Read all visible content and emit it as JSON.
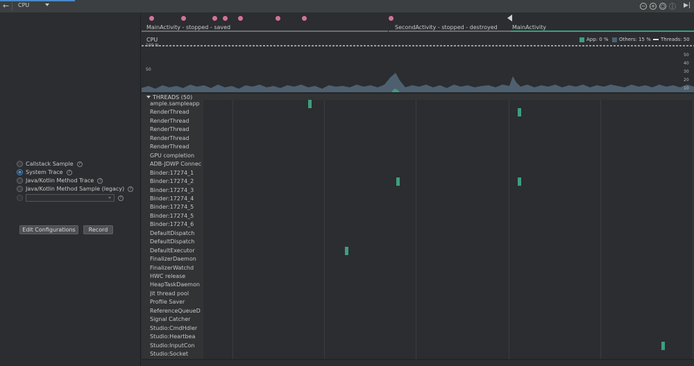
{
  "toolbar": {
    "back_icon": "arrow-left-icon",
    "stage_label": "CPU",
    "icons": [
      "zoom-out-icon",
      "zoom-in-icon",
      "reset-zoom-icon",
      "pause-icon",
      "skip-to-end-icon"
    ]
  },
  "recording": {
    "options": [
      {
        "label": "Callstack Sample",
        "selected": false
      },
      {
        "label": "System Trace",
        "selected": true
      },
      {
        "label": "Java/Kotlin Method Trace",
        "selected": false
      },
      {
        "label": "Java/Kotlin Method Sample (legacy)",
        "selected": false
      }
    ],
    "custom_config_value": "",
    "edit_configurations_label": "Edit Configurations",
    "record_label": "Record"
  },
  "events": {
    "activities": [
      {
        "label": "MainActivity - stopped - saved"
      },
      {
        "label": "SecondActivity - stopped - destroyed"
      },
      {
        "label": "MainActivity"
      }
    ]
  },
  "cpu": {
    "title": "CPU",
    "legend": {
      "app": "App: 0 %",
      "others": "Others: 15 %",
      "threads": "Threads: 50"
    },
    "left_axis": {
      "top": "100 %",
      "mid": "50"
    },
    "right_axis": [
      "50",
      "40",
      "30",
      "20",
      "10"
    ],
    "colors": {
      "app": "#3e9e7d",
      "others": "#4e6070",
      "threads": "#e0e0e0",
      "event_dot": "#d4719b",
      "selection": "#3e9e7d"
    }
  },
  "threads": {
    "header": "THREADS (50)",
    "names": [
      "ample.sampleapp",
      "RenderThread",
      "RenderThread",
      "RenderThread",
      "RenderThread",
      "RenderThread",
      "GPU completion",
      "ADB-JDWP Connec",
      "Binder:17274_1",
      "Binder:17274_2",
      "Binder:17274_3",
      "Binder:17274_4",
      "Binder:17274_5",
      "Binder:17274_5",
      "Binder:17274_6",
      "DefaultDispatch",
      "DefaultDispatch",
      "DefaultExecutor",
      "FinalizerDaemon",
      "FinalizerWatchd",
      "HWC release",
      "HeapTaskDaemon",
      "Jit thread pool",
      "Profile Saver",
      "ReferenceQueueD",
      "Signal Catcher",
      "Studio:CmdHdler",
      "Studio:Heartbea",
      "Studio:InputCon",
      "Studio:Socket"
    ]
  }
}
